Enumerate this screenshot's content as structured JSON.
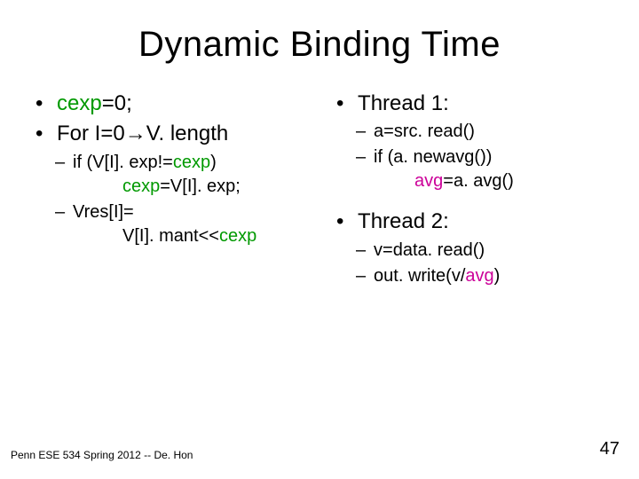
{
  "title": "Dynamic Binding Time",
  "left": {
    "b1_pre": "cexp",
    "b1_post": "=0;",
    "b2_pre": "For I=0",
    "b2_arrow": "→",
    "b2_post": "V. length",
    "s1_pre": "if (V[I]. exp!=",
    "s1_hl": "cexp",
    "s1_post": ")",
    "s1_line2_hl": "cexp",
    "s1_line2_post": "=V[I]. exp;",
    "s2_line1": "Vres[I]=",
    "s2_line2_pre": "V[I]. mant<<",
    "s2_line2_hl": "cexp"
  },
  "right": {
    "t1_label": "Thread 1:",
    "t1_s1": "a=src. read()",
    "t1_s2": "if (a. newavg())",
    "t1_s2_line2_hl": "avg",
    "t1_s2_line2_post": "=a. avg()",
    "t2_label": "Thread 2:",
    "t2_s1": "v=data. read()",
    "t2_s2_pre": "out. write(v/",
    "t2_s2_hl": "avg",
    "t2_s2_post": ")"
  },
  "footer": "Penn ESE 534 Spring 2012 -- De. Hon",
  "page": "47"
}
